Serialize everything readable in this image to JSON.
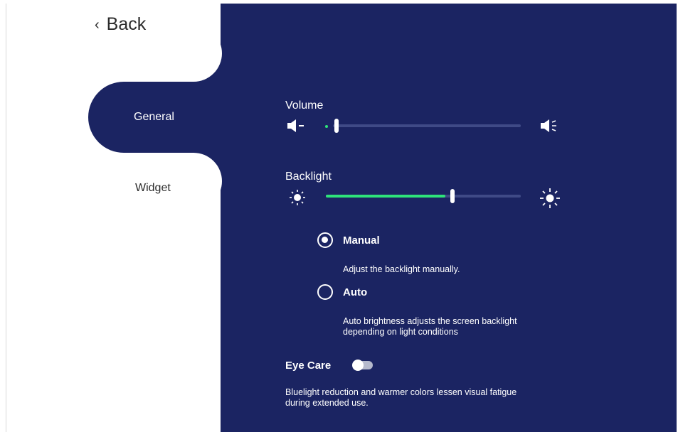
{
  "sidebar": {
    "back_label": "Back",
    "tabs": [
      {
        "label": "General",
        "selected": true
      },
      {
        "label": "Widget",
        "selected": false
      }
    ]
  },
  "settings": {
    "volume": {
      "label": "Volume",
      "value_fraction": 0.04
    },
    "backlight": {
      "label": "Backlight",
      "value_fraction": 0.64,
      "modes": [
        {
          "label": "Manual",
          "selected": true,
          "description": "Adjust the backlight manually."
        },
        {
          "label": "Auto",
          "selected": false,
          "description_line1": "Auto brightness adjusts the screen backlight",
          "description_line2": "depending on light conditions"
        }
      ]
    },
    "eye_care": {
      "label": "Eye Care",
      "enabled": false,
      "description_line1": "Bluelight reduction and warmer colors lessen visual fatigue",
      "description_line2": "during extended use."
    }
  },
  "colors": {
    "panel": "#1b2462",
    "accent": "#2ee37a",
    "track": "#3f4a86"
  },
  "icons": [
    "chevron-left-icon",
    "volume-low-icon",
    "volume-high-icon",
    "brightness-low-icon",
    "brightness-high-icon"
  ]
}
